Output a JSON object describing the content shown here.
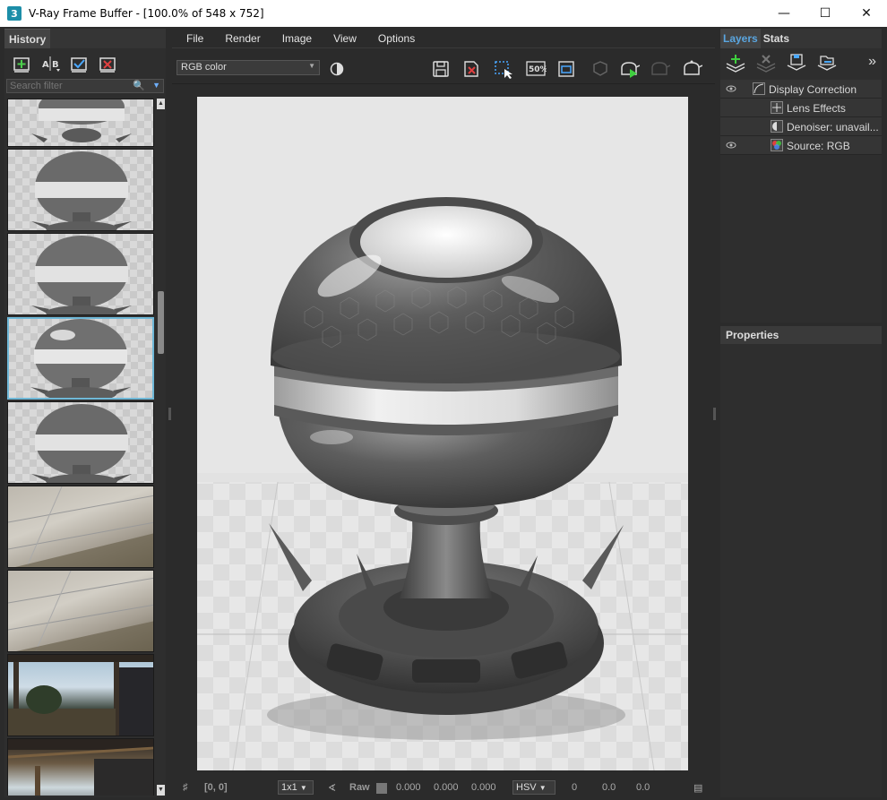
{
  "window": {
    "title": "V-Ray Frame Buffer - [100.0% of 548 x 752]",
    "app_icon_text": "3",
    "controls": [
      "minimize",
      "maximize",
      "close"
    ]
  },
  "history": {
    "tab_label": "History",
    "toolbar": [
      "save-to-history-icon",
      "ab-compare-icon",
      "load-icon",
      "remove-icon"
    ],
    "ab_label": "A|B",
    "search_placeholder": "Search filter",
    "thumbnails": [
      {
        "type": "shaderball-partial"
      },
      {
        "type": "shaderball"
      },
      {
        "type": "shaderball"
      },
      {
        "type": "shaderball",
        "selected": true
      },
      {
        "type": "shaderball"
      },
      {
        "type": "floor"
      },
      {
        "type": "floor"
      },
      {
        "type": "exterior-scene"
      },
      {
        "type": "exterior-scene"
      }
    ]
  },
  "menu": {
    "items": [
      "File",
      "Render",
      "Image",
      "View",
      "Options"
    ]
  },
  "toolbar": {
    "channel": "RGB color",
    "zoom_badge": "50%",
    "icons": [
      "save-image-icon",
      "clear-image-icon",
      "region-render-icon",
      "zoom-50-icon",
      "follow-mouse-icon",
      "track-mouse-icon",
      "render-interactive-icon",
      "render-disabled-icon",
      "render-icon"
    ]
  },
  "render": {
    "description": "V-Ray shader ball with hex pattern material",
    "resolution": "548 x 752"
  },
  "statusbar": {
    "coords": "[0, 0]",
    "zoom_select": "1x1",
    "raw_label": "Raw",
    "rgb_values": [
      "0.000",
      "0.000",
      "0.000"
    ],
    "color_mode": "HSV",
    "hsv_values": [
      "0",
      "0.0",
      "0.0"
    ]
  },
  "layers": {
    "tabs": [
      "Layers",
      "Stats"
    ],
    "active_tab": "Layers",
    "toolbar_icons": [
      "add-layer-icon",
      "delete-layer-icon",
      "save-layers-icon",
      "load-layers-icon",
      "expand-icon"
    ],
    "expand_glyph": "»",
    "items": [
      {
        "label": "Display Correction",
        "visible": true,
        "indent": 1,
        "icon": "curve-icon"
      },
      {
        "label": "Lens Effects",
        "visible": false,
        "indent": 2,
        "icon": "lens-icon"
      },
      {
        "label": "Denoiser: unavail...",
        "visible": false,
        "indent": 2,
        "icon": "denoiser-icon"
      },
      {
        "label": "Source: RGB",
        "visible": true,
        "indent": 2,
        "icon": "source-icon"
      }
    ]
  },
  "properties": {
    "header": "Properties"
  },
  "colors": {
    "accent": "#5aa6e0",
    "panel_bg": "#2e2e2e",
    "selected_border": "#6fb8d8"
  }
}
